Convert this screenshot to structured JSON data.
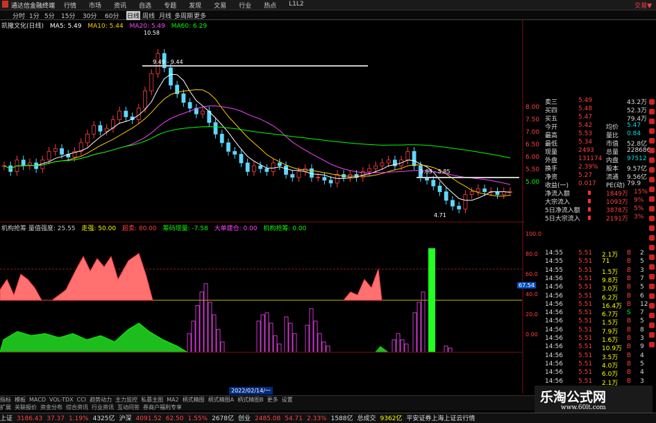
{
  "app": {
    "title": "通达信金融终端",
    "brand": "交易▼"
  },
  "menu": [
    "行情",
    "市场",
    "资讯",
    "自选",
    "专题",
    "发现",
    "文易",
    "行业",
    "热点",
    "L1L2"
  ],
  "periods": [
    "分时",
    "1分",
    "5分",
    "15分",
    "30分",
    "60分",
    "日线",
    "周线",
    "月线",
    "多周期",
    "更多"
  ],
  "selected_period": "日线",
  "stock": {
    "name": "凯撒文化(日线)"
  },
  "ma_legend": [
    {
      "label": "MA5: 5.49",
      "color": "#ffffff"
    },
    {
      "label": "MA10: 5.44",
      "color": "#ffcc00"
    },
    {
      "label": "MA20: 5.49",
      "color": "#ff44ff"
    },
    {
      "label": "MA60: 6.29",
      "color": "#00ff00"
    }
  ],
  "price_notes": {
    "high_mark": "10.58",
    "level_1": "9.49 - 9.44",
    "level_2": "5.85 - 5.85",
    "low_mark": "4.71"
  },
  "indicator_legend": [
    {
      "label": "机构抢筹 量值强度: 25.55",
      "color": "#cccccc"
    },
    {
      "label": "走强: 50.00",
      "color": "#ffff00"
    },
    {
      "label": "超卖: 80.00",
      "color": "#ff4040"
    },
    {
      "label": "筹码增量: -7.58",
      "color": "#00ff00"
    },
    {
      "label": "大单建仓: 0.00",
      "color": "#ff44ff"
    },
    {
      "label": "机构抢筹: 0.00",
      "color": "#00ff00"
    }
  ],
  "y_axis_price": [
    "8.00",
    "7.50",
    "7.00",
    "6.50",
    "6.00",
    "5.50",
    "5.00"
  ],
  "y_axis_ind": [
    "100.0",
    "80.0",
    "60.0",
    "40.0",
    "20.0",
    "0.00"
  ],
  "ind_marker": "67.54",
  "date_label": "2022/02/14/一",
  "quote_rows": [
    {
      "l": "卖三",
      "v": "5.49",
      "l2": "",
      "v2": "43.2万"
    },
    {
      "l": "买四",
      "v": "5.48",
      "l2": "",
      "v2": "52.3万"
    },
    {
      "l": "买五",
      "v": "5.47",
      "l2": "",
      "v2": "79.4万"
    },
    {
      "l": "今开",
      "v": "5.42",
      "l2": "均价",
      "v2": "5.47"
    },
    {
      "l": "最高",
      "v": "5.53",
      "l2": "量比",
      "v2": "0.84"
    },
    {
      "l": "最低",
      "v": "5.34",
      "l2": "市值",
      "v2": "52.8亿"
    },
    {
      "l": "现量",
      "v": "2493",
      "l2": "总量",
      "v2": "228686"
    },
    {
      "l": "外盘",
      "v": "131174",
      "l2": "内盘",
      "v2": "97512"
    },
    {
      "l": "换手",
      "v": "2.39%",
      "l2": "股本",
      "v2": "9.57亿"
    },
    {
      "l": "净资",
      "v": "5.27",
      "l2": "流通",
      "v2": "9.56亿"
    },
    {
      "l": "收益(一)",
      "v": "0.017",
      "l2": "PE(动)",
      "v2": "79.9"
    },
    {
      "l": "净流入额",
      "v": "",
      "l2": "1849万",
      "v2": "15%"
    },
    {
      "l": "大宗流入",
      "v": "",
      "l2": "1093万",
      "v2": "9%"
    },
    {
      "l": "5日净流入额",
      "v": "",
      "l2": "3878万",
      "v2": "5%"
    },
    {
      "l": "5日大宗流入",
      "v": "",
      "l2": "2191万",
      "v2": "3%"
    }
  ],
  "ticks": [
    {
      "t": "14:55",
      "p": "5.51",
      "v": "2.1万",
      "d": "B",
      "n": "2"
    },
    {
      "t": "14:55",
      "p": "5.51",
      "v": "71",
      "d": "B",
      "n": "5"
    },
    {
      "t": "14:55",
      "p": "5.51",
      "v": "1.5万",
      "d": "B",
      "n": "3"
    },
    {
      "t": "14:56",
      "p": "5.51",
      "v": "9.8万",
      "d": "B",
      "n": "7"
    },
    {
      "t": "14:56",
      "p": "5.51",
      "v": "3.0万",
      "d": "B",
      "n": "5"
    },
    {
      "t": "14:56",
      "p": "5.51",
      "v": "6.2万",
      "d": "B",
      "n": "6"
    },
    {
      "t": "14:56",
      "p": "5.51",
      "v": "16.4万",
      "d": "B",
      "n": "12"
    },
    {
      "t": "14:56",
      "p": "5.51",
      "v": "6.7万",
      "d": "S",
      "n": "7"
    },
    {
      "t": "14:56",
      "p": "5.51",
      "v": "1.5万",
      "d": "B",
      "n": "5"
    },
    {
      "t": "14:56",
      "p": "5.51",
      "v": "7.9万",
      "d": "B",
      "n": "8"
    },
    {
      "t": "14:56",
      "p": "5.51",
      "v": "1.6万",
      "d": "B",
      "n": "3"
    },
    {
      "t": "14:56",
      "p": "5.51",
      "v": "10.9万",
      "d": "B",
      "n": "9"
    },
    {
      "t": "14:56",
      "p": "5.51",
      "v": "3.5万",
      "d": "B",
      "n": "4"
    },
    {
      "t": "14:56",
      "p": "5.51",
      "v": "4.0万",
      "d": "B",
      "n": "5"
    },
    {
      "t": "14:56",
      "p": "5.51",
      "v": "6.0万",
      "d": "B",
      "n": "4"
    },
    {
      "t": "14:56",
      "p": "5.51",
      "v": "2.1万",
      "d": "B",
      "n": "3"
    },
    {
      "t": "14:56",
      "p": "5.51",
      "v": "11.1万",
      "d": "B",
      "n": "9"
    },
    {
      "t": "14:56",
      "p": "5.50",
      "v": "0.2万",
      "d": "S",
      "n": "2"
    },
    {
      "t": "14:56",
      "p": "5.51",
      "v": "5.2万",
      "d": "B",
      "n": "6"
    }
  ],
  "tabs_row1": [
    "A股",
    "股票",
    "基金",
    "港股",
    "美股",
    "期货",
    "外汇",
    "债券",
    "更多"
  ],
  "tabs_row2": [
    "指标",
    "模板",
    "MACD",
    "VOL-TDX",
    "CCI",
    "趋势动力",
    "主力监控",
    "私募主图",
    "MA2",
    "柄式精图",
    "柄式精图A",
    "柄式精图B",
    "更多",
    "设置"
  ],
  "tabs_row3": [
    "扩展",
    "关联报价",
    "资金分布",
    "综合资讯",
    "行业资讯",
    "互动问答",
    "券商户福利专享"
  ],
  "status": [
    {
      "l": "上证",
      "v": "3186.43",
      "c": "37.37",
      "p": "1.19%",
      "a": "4325亿"
    },
    {
      "l": "沪深",
      "v": "4091.52",
      "c": "62.50",
      "p": "1.55%",
      "a": "2678亿"
    },
    {
      "l": "创业",
      "v": "2485.08",
      "c": "54.71",
      "p": "2.33%",
      "a": "1588亿"
    }
  ],
  "status_tail": {
    "label": "总成交",
    "value": "9362亿",
    "broker": "平安证券上海上证云行情"
  },
  "watermark": {
    "cn": "乐淘公式网",
    "url": "www.60lt.com"
  }
}
